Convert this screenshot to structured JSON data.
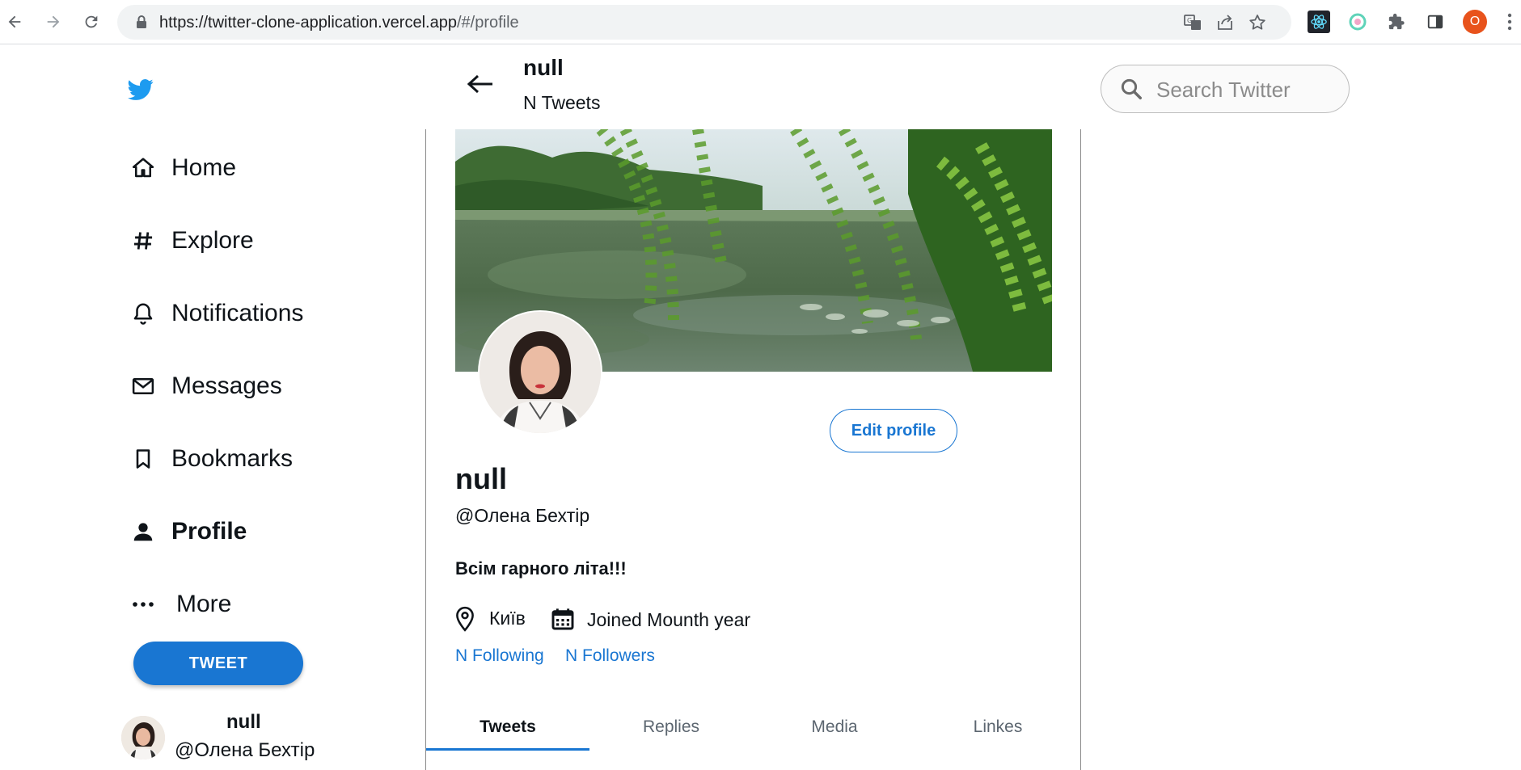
{
  "browser": {
    "url_host": "https://twitter-clone-application.vercel.app",
    "url_path": "/#/profile",
    "profile_initial": "O"
  },
  "sidebar": {
    "items": [
      {
        "label": "Home",
        "icon": "home-icon"
      },
      {
        "label": "Explore",
        "icon": "hash-icon"
      },
      {
        "label": "Notifications",
        "icon": "bell-icon"
      },
      {
        "label": "Messages",
        "icon": "mail-icon"
      },
      {
        "label": "Bookmarks",
        "icon": "bookmark-icon"
      },
      {
        "label": "Profile",
        "icon": "person-icon",
        "active": true
      },
      {
        "label": "More",
        "icon": "more-icon"
      }
    ],
    "tweet_button": "TWEET",
    "user": {
      "name": "null",
      "handle": "@Олена Бехтір"
    }
  },
  "header": {
    "name": "null",
    "tweets_count": "N Tweets"
  },
  "profile": {
    "edit_button": "Edit profile",
    "name": "null",
    "handle": "@Олена Бехтір",
    "bio": "Всім гарного літа!!!",
    "location": "Київ",
    "joined": "Joined Mounth year",
    "following": "N Following",
    "followers": "N Followers"
  },
  "tabs": [
    {
      "label": "Tweets",
      "active": true
    },
    {
      "label": "Replies"
    },
    {
      "label": "Media"
    },
    {
      "label": "Linkes"
    }
  ],
  "search": {
    "placeholder": "Search Twitter"
  },
  "colors": {
    "accent": "#1976d2",
    "twitter_blue": "#1d9bf0",
    "profile_badge": "#e8531c"
  }
}
